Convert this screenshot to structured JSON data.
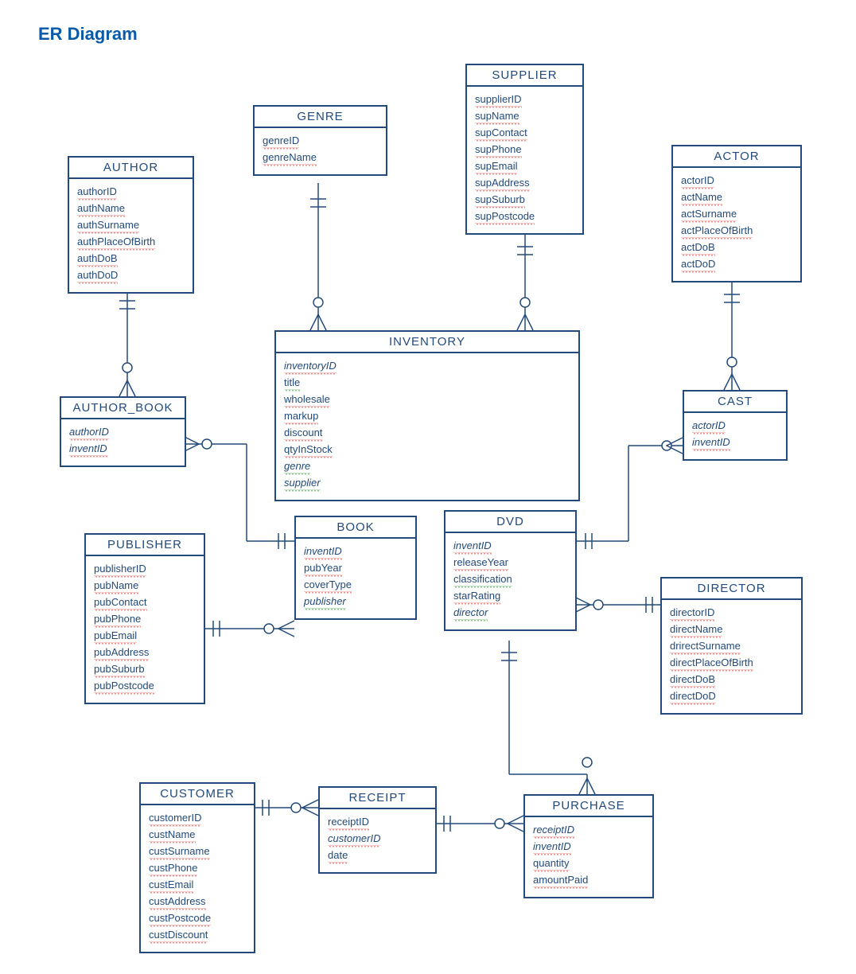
{
  "title": "ER Diagram",
  "entities": {
    "author": {
      "name": "AUTHOR",
      "attrs": [
        {
          "t": "authorID",
          "pk": 1
        },
        {
          "t": "authName"
        },
        {
          "t": "authSurname"
        },
        {
          "t": "authPlaceOfBirth"
        },
        {
          "t": "authDoB"
        },
        {
          "t": "authDoD"
        }
      ]
    },
    "genre": {
      "name": "GENRE",
      "attrs": [
        {
          "t": "genreID",
          "pk": 1
        },
        {
          "t": "genreName"
        }
      ]
    },
    "supplier": {
      "name": "SUPPLIER",
      "attrs": [
        {
          "t": "supplierID",
          "pk": 1
        },
        {
          "t": "supName"
        },
        {
          "t": "supContact"
        },
        {
          "t": "supPhone"
        },
        {
          "t": "supEmail"
        },
        {
          "t": "supAddress"
        },
        {
          "t": "supSuburb"
        },
        {
          "t": "supPostcode"
        }
      ]
    },
    "actor": {
      "name": "ACTOR",
      "attrs": [
        {
          "t": "actorID",
          "pk": 1
        },
        {
          "t": "actName"
        },
        {
          "t": "actSurname"
        },
        {
          "t": "actPlaceOfBirth"
        },
        {
          "t": "actDoB"
        },
        {
          "t": "actDoD"
        }
      ]
    },
    "author_book": {
      "name": "AUTHOR_BOOK",
      "attrs": [
        {
          "t": "authorID",
          "pk": 1,
          "fk": 1
        },
        {
          "t": "inventID",
          "fk": 1
        }
      ]
    },
    "inventory": {
      "name": "INVENTORY",
      "attrs": [
        {
          "t": "inventoryID",
          "pk": 1,
          "fk": 1
        },
        {
          "t": "title",
          "g": 1
        },
        {
          "t": "wholesale"
        },
        {
          "t": "markup"
        },
        {
          "t": "discount"
        },
        {
          "t": "qtyInStock"
        },
        {
          "t": "genre",
          "fk": 1,
          "g": 1
        },
        {
          "t": "supplier",
          "fk": 1,
          "g": 1
        }
      ]
    },
    "cast": {
      "name": "CAST",
      "attrs": [
        {
          "t": "actorID",
          "pk": 1,
          "fk": 1
        },
        {
          "t": "inventID",
          "fk": 1
        }
      ]
    },
    "publisher": {
      "name": "PUBLISHER",
      "attrs": [
        {
          "t": "publisherID",
          "pk": 1
        },
        {
          "t": "pubName"
        },
        {
          "t": "pubContact"
        },
        {
          "t": "pubPhone"
        },
        {
          "t": "pubEmail"
        },
        {
          "t": "pubAddress"
        },
        {
          "t": "pubSuburb"
        },
        {
          "t": "pubPostcode"
        }
      ]
    },
    "book": {
      "name": "BOOK",
      "attrs": [
        {
          "t": "inventID",
          "pk": 1,
          "fk": 1
        },
        {
          "t": "pubYear"
        },
        {
          "t": "coverType"
        },
        {
          "t": "publisher",
          "fk": 1,
          "g": 1
        }
      ]
    },
    "dvd": {
      "name": "DVD",
      "attrs": [
        {
          "t": "inventID",
          "pk": 1,
          "fk": 1
        },
        {
          "t": "releaseYear"
        },
        {
          "t": "classification",
          "g": 1
        },
        {
          "t": "starRating"
        },
        {
          "t": "director",
          "fk": 1,
          "g": 1
        }
      ]
    },
    "director": {
      "name": "DIRECTOR",
      "attrs": [
        {
          "t": "directorID",
          "pk": 1
        },
        {
          "t": "directName"
        },
        {
          "t": "drirectSurname"
        },
        {
          "t": "directPlaceOfBirth"
        },
        {
          "t": "directDoB"
        },
        {
          "t": "directDoD"
        }
      ]
    },
    "customer": {
      "name": "CUSTOMER",
      "attrs": [
        {
          "t": "customerID",
          "pk": 1
        },
        {
          "t": "custName"
        },
        {
          "t": "custSurname"
        },
        {
          "t": "custPhone"
        },
        {
          "t": "custEmail"
        },
        {
          "t": "custAddress"
        },
        {
          "t": "custPostcode"
        },
        {
          "t": "custDiscount"
        }
      ]
    },
    "receipt": {
      "name": "RECEIPT",
      "attrs": [
        {
          "t": "receiptID",
          "pk": 1
        },
        {
          "t": "customerID",
          "fk": 1
        },
        {
          "t": "date"
        }
      ]
    },
    "purchase": {
      "name": "PURCHASE",
      "attrs": [
        {
          "t": "receiptID",
          "pk": 1,
          "fk": 1
        },
        {
          "t": "inventID",
          "fk": 1
        },
        {
          "t": "quantity"
        },
        {
          "t": "amountPaid"
        }
      ]
    }
  },
  "chart_data": {
    "type": "er-diagram",
    "entities": [
      {
        "name": "AUTHOR",
        "attributes": [
          "authorID",
          "authName",
          "authSurname",
          "authPlaceOfBirth",
          "authDoB",
          "authDoD"
        ],
        "pk": [
          "authorID"
        ]
      },
      {
        "name": "GENRE",
        "attributes": [
          "genreID",
          "genreName"
        ],
        "pk": [
          "genreID"
        ]
      },
      {
        "name": "SUPPLIER",
        "attributes": [
          "supplierID",
          "supName",
          "supContact",
          "supPhone",
          "supEmail",
          "supAddress",
          "supSuburb",
          "supPostcode"
        ],
        "pk": [
          "supplierID"
        ]
      },
      {
        "name": "ACTOR",
        "attributes": [
          "actorID",
          "actName",
          "actSurname",
          "actPlaceOfBirth",
          "actDoB",
          "actDoD"
        ],
        "pk": [
          "actorID"
        ]
      },
      {
        "name": "AUTHOR_BOOK",
        "attributes": [
          "authorID",
          "inventID"
        ],
        "pk": [
          "authorID"
        ],
        "fk": [
          "authorID",
          "inventID"
        ]
      },
      {
        "name": "INVENTORY",
        "attributes": [
          "inventoryID",
          "title",
          "wholesale",
          "markup",
          "discount",
          "qtyInStock",
          "genre",
          "supplier"
        ],
        "pk": [
          "inventoryID"
        ],
        "fk": [
          "genre",
          "supplier"
        ]
      },
      {
        "name": "CAST",
        "attributes": [
          "actorID",
          "inventID"
        ],
        "pk": [
          "actorID"
        ],
        "fk": [
          "actorID",
          "inventID"
        ]
      },
      {
        "name": "PUBLISHER",
        "attributes": [
          "publisherID",
          "pubName",
          "pubContact",
          "pubPhone",
          "pubEmail",
          "pubAddress",
          "pubSuburb",
          "pubPostcode"
        ],
        "pk": [
          "publisherID"
        ]
      },
      {
        "name": "BOOK",
        "attributes": [
          "inventID",
          "pubYear",
          "coverType",
          "publisher"
        ],
        "pk": [
          "inventID"
        ],
        "fk": [
          "inventID",
          "publisher"
        ]
      },
      {
        "name": "DVD",
        "attributes": [
          "inventID",
          "releaseYear",
          "classification",
          "starRating",
          "director"
        ],
        "pk": [
          "inventID"
        ],
        "fk": [
          "inventID",
          "director"
        ]
      },
      {
        "name": "DIRECTOR",
        "attributes": [
          "directorID",
          "directName",
          "drirectSurname",
          "directPlaceOfBirth",
          "directDoB",
          "directDoD"
        ],
        "pk": [
          "directorID"
        ]
      },
      {
        "name": "CUSTOMER",
        "attributes": [
          "customerID",
          "custName",
          "custSurname",
          "custPhone",
          "custEmail",
          "custAddress",
          "custPostcode",
          "custDiscount"
        ],
        "pk": [
          "customerID"
        ]
      },
      {
        "name": "RECEIPT",
        "attributes": [
          "receiptID",
          "customerID",
          "date"
        ],
        "pk": [
          "receiptID"
        ],
        "fk": [
          "customerID"
        ]
      },
      {
        "name": "PURCHASE",
        "attributes": [
          "receiptID",
          "inventID",
          "quantity",
          "amountPaid"
        ],
        "pk": [
          "receiptID"
        ],
        "fk": [
          "receiptID",
          "inventID"
        ]
      }
    ],
    "relationships": [
      {
        "from": "AUTHOR",
        "to": "AUTHOR_BOOK",
        "type": "one-to-many"
      },
      {
        "from": "AUTHOR_BOOK",
        "to": "BOOK",
        "type": "many-to-one-optional"
      },
      {
        "from": "GENRE",
        "to": "INVENTORY",
        "type": "one-to-many"
      },
      {
        "from": "SUPPLIER",
        "to": "INVENTORY",
        "type": "one-to-many"
      },
      {
        "from": "ACTOR",
        "to": "CAST",
        "type": "one-to-many"
      },
      {
        "from": "CAST",
        "to": "DVD",
        "type": "many-to-one-optional"
      },
      {
        "from": "PUBLISHER",
        "to": "BOOK",
        "type": "one-to-many-optional"
      },
      {
        "from": "INVENTORY",
        "to": "BOOK",
        "type": "one-to-one"
      },
      {
        "from": "INVENTORY",
        "to": "DVD",
        "type": "one-to-one"
      },
      {
        "from": "DVD",
        "to": "DIRECTOR",
        "type": "many-to-one-optional"
      },
      {
        "from": "DVD",
        "to": "PURCHASE",
        "type": "one-to-many"
      },
      {
        "from": "CUSTOMER",
        "to": "RECEIPT",
        "type": "one-to-many-optional"
      },
      {
        "from": "RECEIPT",
        "to": "PURCHASE",
        "type": "one-to-many-optional"
      }
    ]
  }
}
